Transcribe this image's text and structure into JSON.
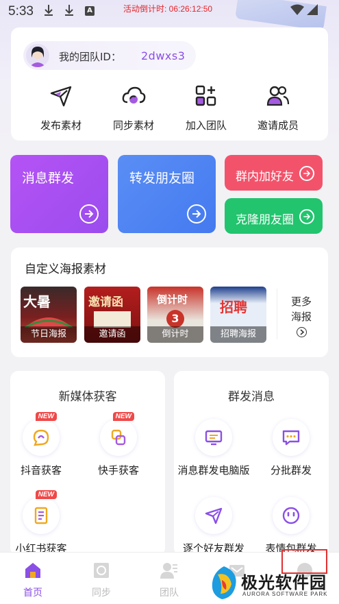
{
  "status_bar": {
    "time": "5:33",
    "countdown": "活动倒计时: 06:26:12:50",
    "a_icon": "A"
  },
  "team": {
    "id_label": "我的团队ID：",
    "id_value": "2dwxs3",
    "actions": [
      {
        "label": "发布素材",
        "icon": "send-icon"
      },
      {
        "label": "同步素材",
        "icon": "cloud-sync-icon"
      },
      {
        "label": "加入团队",
        "icon": "grid-add-icon"
      },
      {
        "label": "邀请成员",
        "icon": "people-icon"
      }
    ]
  },
  "tiles": {
    "mass_message": {
      "label": "消息群发",
      "color": "#a64ef2"
    },
    "forward_moments": {
      "label": "转发朋友圈",
      "color": "#4c80f2"
    },
    "group_add_friend": {
      "label": "群内加好友",
      "color": "#f2516a"
    },
    "clone_moments": {
      "label": "克隆朋友圈",
      "color": "#22c46e"
    }
  },
  "posters": {
    "title": "自定义海报素材",
    "items": [
      {
        "caption": "节日海报",
        "art": "大暑"
      },
      {
        "caption": "邀请函",
        "art": "邀请函"
      },
      {
        "caption": "倒计时",
        "art": "倒计时"
      },
      {
        "caption": "招聘海报",
        "art": "招聘"
      }
    ],
    "more_line1": "更多",
    "more_line2": "海报"
  },
  "new_media": {
    "title": "新媒体获客",
    "items": [
      {
        "label": "抖音获客",
        "badge": "NEW"
      },
      {
        "label": "快手获客",
        "badge": "NEW"
      },
      {
        "label": "小红书获客",
        "badge": "NEW"
      }
    ]
  },
  "group_msg": {
    "title": "群发消息",
    "items": [
      {
        "label": "消息群发电脑版"
      },
      {
        "label": "分批群发"
      },
      {
        "label": "逐个好友群发"
      },
      {
        "label": "表情包群发"
      }
    ]
  },
  "tabs": [
    {
      "label": "首页",
      "active": true
    },
    {
      "label": "同步",
      "active": false
    },
    {
      "label": "团队",
      "active": false
    },
    {
      "label": "",
      "active": false
    },
    {
      "label": "",
      "active": false
    }
  ],
  "watermark": {
    "text": "极光软件园",
    "sub": "AURORA SOFTWARE PARK"
  },
  "colors": {
    "accent": "#8a4fe6",
    "badge_red": "#f04848"
  }
}
